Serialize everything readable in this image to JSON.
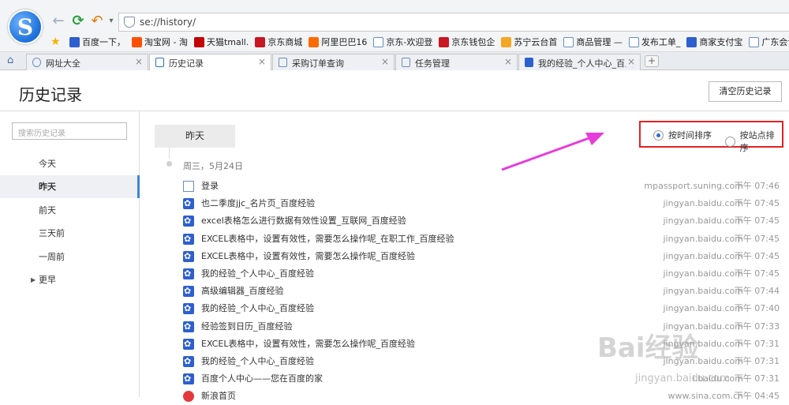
{
  "browser": {
    "address": "se://history/",
    "bookmarks": [
      {
        "label": "百度一下，",
        "icon": "baidu-paw-icon",
        "color": "#2d5fcf"
      },
      {
        "label": "淘宝网 - 淘",
        "icon": "taobao-icon",
        "color": "#ff5000"
      },
      {
        "label": "天猫tmall.",
        "icon": "tmall-icon",
        "color": "#c40000"
      },
      {
        "label": "京东商城",
        "icon": "jd-icon",
        "color": "#c91623"
      },
      {
        "label": "阿里巴巴16",
        "icon": "alibaba-icon",
        "color": "#ff6a00"
      },
      {
        "label": "京东-欢迎登",
        "icon": "page-icon",
        "color": "#6c8ebf"
      },
      {
        "label": "京东钱包企",
        "icon": "jd-icon",
        "color": "#c91623"
      },
      {
        "label": "苏宁云台首",
        "icon": "suning-icon",
        "color": "#f5a623"
      },
      {
        "label": "商品管理 —",
        "icon": "page-icon",
        "color": "#6c8ebf"
      },
      {
        "label": "发布工单_",
        "icon": "page-icon",
        "color": "#6c8ebf"
      },
      {
        "label": "商家支付宝",
        "icon": "baidu-paw-icon",
        "color": "#2d5fcf"
      },
      {
        "label": "广东会计信",
        "icon": "page-icon",
        "color": "#6c8ebf"
      },
      {
        "label": "会",
        "icon": "page-icon",
        "color": "#6c8ebf"
      }
    ],
    "tabs": [
      {
        "label": "网址大全"
      },
      {
        "label": "历史记录"
      },
      {
        "label": "采购订单查询"
      },
      {
        "label": "任务管理"
      },
      {
        "label": "我的经验_个人中心_百度"
      }
    ]
  },
  "header": {
    "title": "历史记录",
    "clear_button": "清空历史记录"
  },
  "sidebar": {
    "search_placeholder": "搜索历史记录",
    "items": [
      {
        "label": "今天"
      },
      {
        "label": "昨天"
      },
      {
        "label": "前天"
      },
      {
        "label": "三天前"
      },
      {
        "label": "一周前"
      },
      {
        "label": "更早"
      }
    ]
  },
  "main": {
    "day_label": "昨天",
    "date_label": "周三，5月24日",
    "sort_by_time": "按时间排序",
    "sort_by_site": "按站点排序",
    "rows": [
      {
        "icon": "doc",
        "title": "登录",
        "site": "mpassport.suning.com",
        "time": "下午 07:46"
      },
      {
        "icon": "paw",
        "title": "也二季度jjc_名片页_百度经验",
        "site": "jingyan.baidu.com",
        "time": "下午 07:45"
      },
      {
        "icon": "paw",
        "title": "excel表格怎么进行数据有效性设置_互联网_百度经验",
        "site": "jingyan.baidu.com",
        "time": "下午 07:45"
      },
      {
        "icon": "paw",
        "title": "EXCEL表格中，设置有效性，需要怎么操作呢_在职工作_百度经验",
        "site": "jingyan.baidu.com",
        "time": "下午 07:45"
      },
      {
        "icon": "paw",
        "title": "EXCEL表格中，设置有效性，需要怎么操作呢_百度经验",
        "site": "jingyan.baidu.com",
        "time": "下午 07:45"
      },
      {
        "icon": "paw",
        "title": "我的经验_个人中心_百度经验",
        "site": "jingyan.baidu.com",
        "time": "下午 07:45"
      },
      {
        "icon": "paw",
        "title": "高级编辑器_百度经验",
        "site": "jingyan.baidu.com",
        "time": "下午 07:44"
      },
      {
        "icon": "paw",
        "title": "我的经验_个人中心_百度经验",
        "site": "jingyan.baidu.com",
        "time": "下午 07:40"
      },
      {
        "icon": "paw",
        "title": "经验签到日历_百度经验",
        "site": "jingyan.baidu.com",
        "time": "下午 07:33"
      },
      {
        "icon": "paw",
        "title": "EXCEL表格中，设置有效性，需要怎么操作呢_百度经验",
        "site": "jingyan.baidu.com",
        "time": "下午 07:31"
      },
      {
        "icon": "paw",
        "title": "我的经验_个人中心_百度经验",
        "site": "jingyan.baidu.com",
        "time": "下午 07:31"
      },
      {
        "icon": "paw",
        "title": "百度个人中心——您在百度的家",
        "site": "i.baidu.com",
        "time": "下午 07:31"
      },
      {
        "icon": "sina",
        "title": "新浪首页",
        "site": "www.sina.com.cn",
        "time": "下午 04:45"
      }
    ]
  },
  "watermark": {
    "brand": "Bai经验",
    "domain": "jingyan.baidu.com"
  }
}
